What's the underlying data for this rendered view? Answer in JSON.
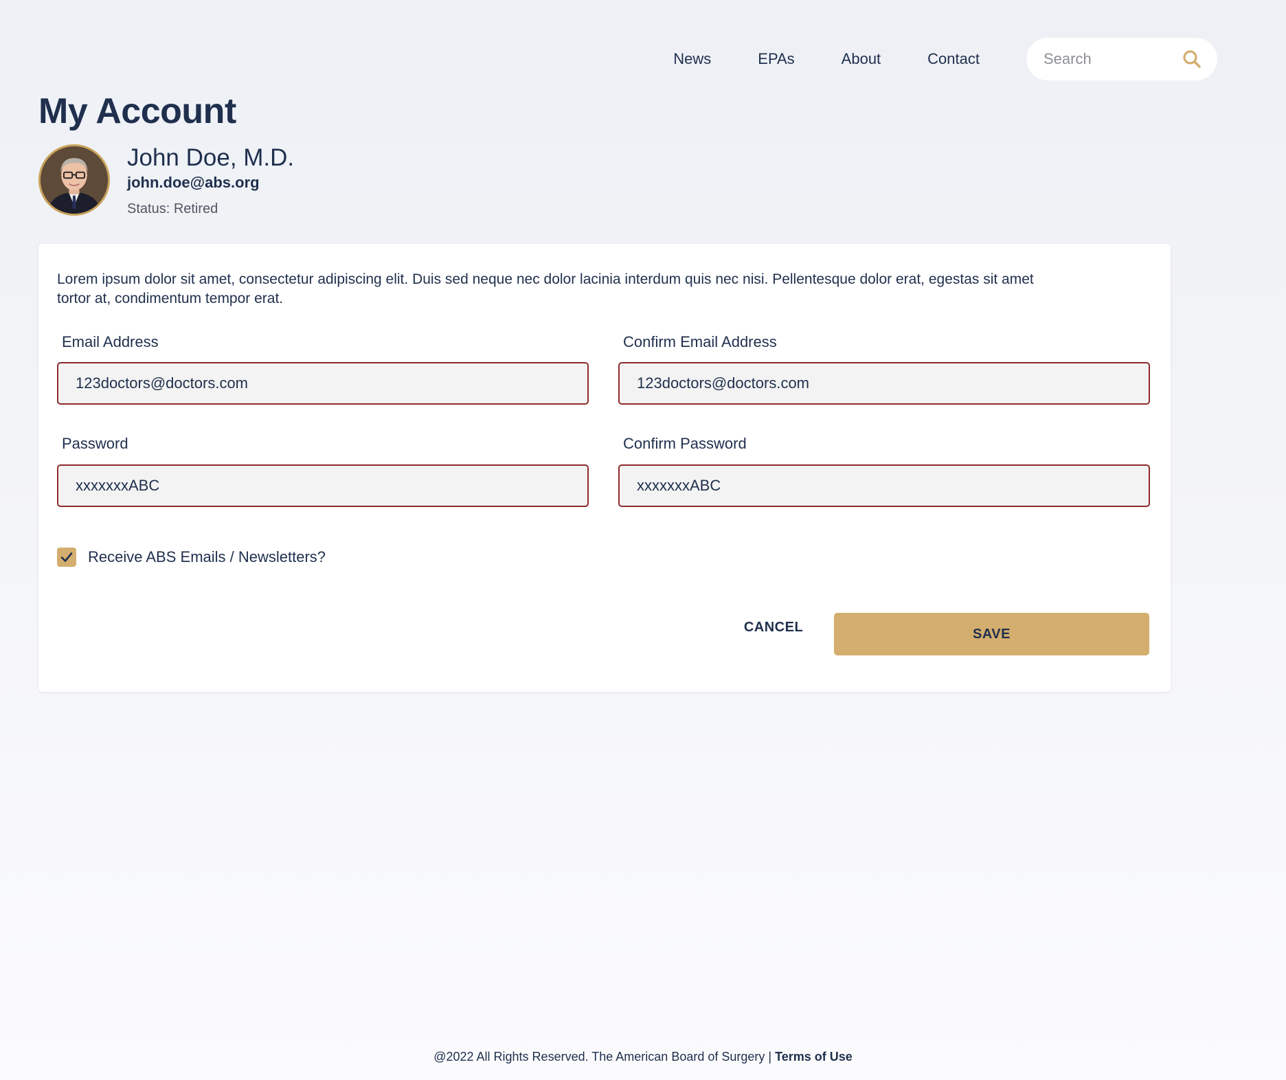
{
  "nav": {
    "links": [
      "News",
      "EPAs",
      "About",
      "Contact"
    ],
    "search_placeholder": "Search",
    "search_icon": "search-icon"
  },
  "header": {
    "title": "My Account",
    "name": "John Doe, M.D.",
    "email": "john.doe@abs.org",
    "status": "Status: Retired"
  },
  "form": {
    "intro": "Lorem ipsum dolor sit amet, consectetur adipiscing elit. Duis sed neque nec dolor lacinia interdum quis nec nisi. Pellentesque dolor erat, egestas sit amet tortor at, condimentum tempor erat.",
    "email_label": "Email Address",
    "email_value": "123doctors@doctors.com",
    "confirm_email_label": "Confirm Email Address",
    "confirm_email_value": "123doctors@doctors.com",
    "password_label": "Password",
    "password_value": "xxxxxxxABC",
    "confirm_password_label": "Confirm Password",
    "confirm_password_value": "xxxxxxxABC",
    "newsletter_label": "Receive ABS Emails / Newsletters?",
    "newsletter_checked": true,
    "cancel_label": "CANCEL",
    "save_label": "SAVE"
  },
  "footer": {
    "copyright": "@2022 All Rights Reserved. The American Board of Surgery | ",
    "terms_label": "Terms of Use"
  },
  "colors": {
    "navy": "#1f2f4d",
    "gold": "#d4ae6e",
    "input_border": "#8e2a2a",
    "input_bg": "#f3f3f3"
  }
}
